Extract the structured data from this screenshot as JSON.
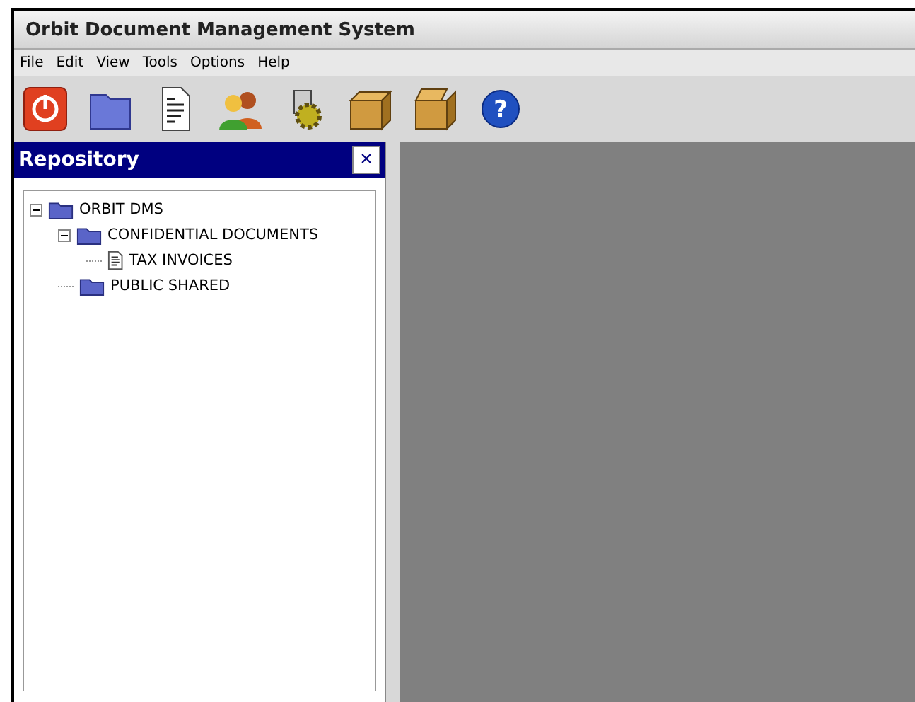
{
  "window": {
    "title": "Orbit Document Management System"
  },
  "menu": [
    "File",
    "Edit",
    "View",
    "Tools",
    "Options",
    "Help"
  ],
  "toolbar": [
    {
      "kind": "power"
    },
    {
      "kind": "folder"
    },
    {
      "kind": "document"
    },
    {
      "kind": "users"
    },
    {
      "kind": "gear"
    },
    {
      "kind": "box-closed"
    },
    {
      "kind": "box-open"
    },
    {
      "kind": "help",
      "glyph": "?"
    }
  ],
  "panel": {
    "title": "Repository",
    "close": "×"
  },
  "tree": [
    {
      "kind": "folder",
      "label": "ORBIT DMS",
      "expanded": true,
      "children": [
        {
          "kind": "folder",
          "label": "CONFIDENTIAL DOCUMENTS",
          "expanded": true,
          "children": [
            {
              "kind": "document",
              "label": "TAX INVOICES"
            }
          ]
        },
        {
          "kind": "folder",
          "label": "PUBLIC SHARED"
        }
      ]
    }
  ]
}
